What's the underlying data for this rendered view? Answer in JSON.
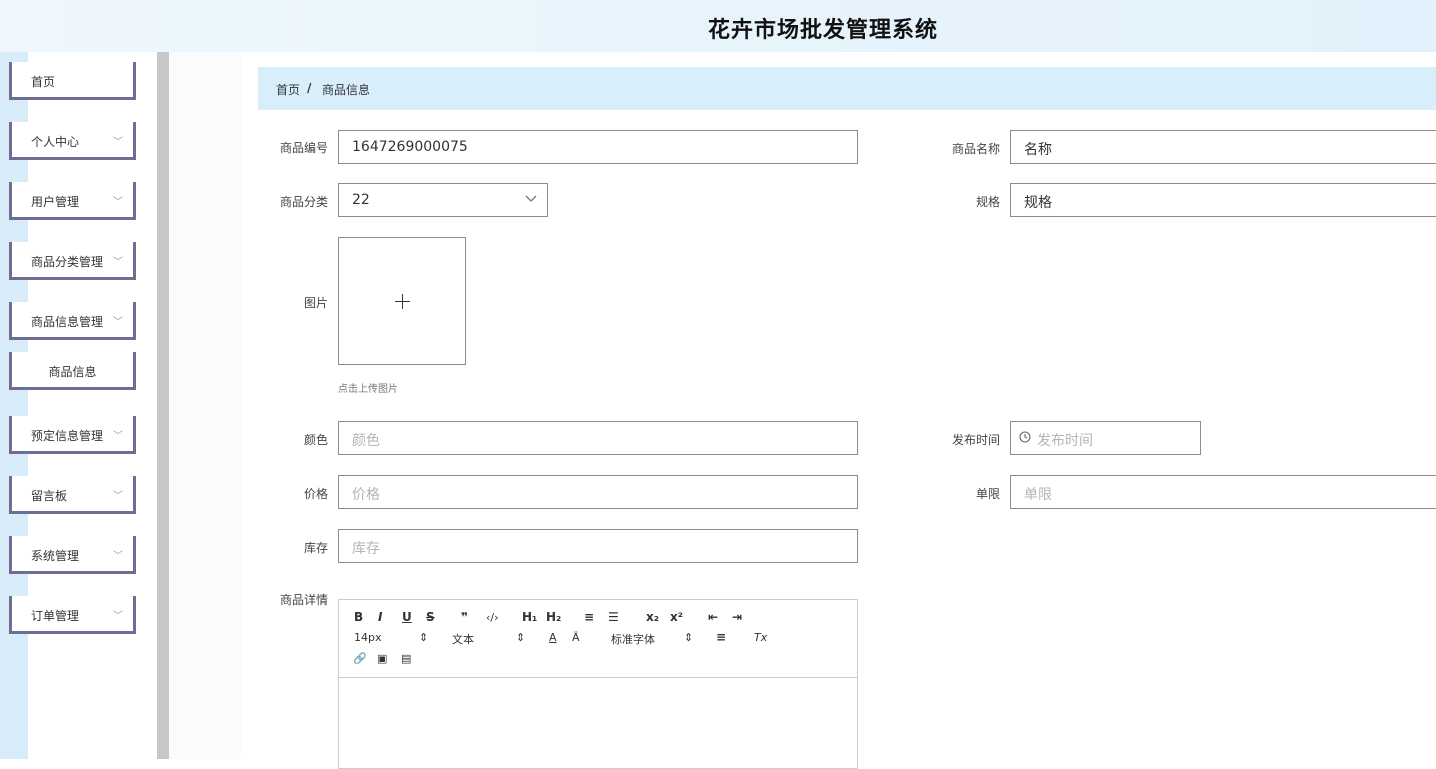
{
  "app": {
    "title": "花卉市场批发管理系统"
  },
  "sidebar": {
    "items": [
      {
        "label": "首页",
        "chevron": false
      },
      {
        "label": "个人中心",
        "chevron": true
      },
      {
        "label": "用户管理",
        "chevron": true
      },
      {
        "label": "商品分类管理",
        "chevron": true
      },
      {
        "label": "商品信息管理",
        "chevron": true
      },
      {
        "label": "商品信息",
        "chevron": false,
        "sub": true
      },
      {
        "label": "预定信息管理",
        "chevron": true
      },
      {
        "label": "留言板",
        "chevron": true
      },
      {
        "label": "系统管理",
        "chevron": true
      },
      {
        "label": "订单管理",
        "chevron": true
      }
    ],
    "chevron_glyph": "﹀"
  },
  "breadcrumb": {
    "home": "首页",
    "separator": "/",
    "current": "商品信息"
  },
  "form": {
    "code": {
      "label": "商品编号",
      "value": "1647269000075"
    },
    "name": {
      "label": "商品名称",
      "value": "名称"
    },
    "category": {
      "label": "商品分类",
      "value": "22"
    },
    "spec": {
      "label": "规格",
      "value": "规格"
    },
    "image": {
      "label": "图片",
      "hint": "点击上传图片"
    },
    "color": {
      "label": "颜色",
      "placeholder": "颜色"
    },
    "publish_time": {
      "label": "发布时间",
      "placeholder": "发布时间"
    },
    "price": {
      "label": "价格",
      "placeholder": "价格"
    },
    "limit": {
      "label": "单限",
      "placeholder": "单限"
    },
    "stock": {
      "label": "库存",
      "placeholder": "库存"
    },
    "detail": {
      "label": "商品详情"
    }
  },
  "editor": {
    "row1": [
      "B",
      "I",
      "U",
      "S",
      "❞",
      "‹/›",
      "H₁",
      "H₂",
      "≡",
      "☰",
      "x₂",
      "x²",
      "⇤",
      "⇥"
    ],
    "font_size": "14px",
    "block_type": "文本",
    "font_family": "标准字体",
    "select_arrow": "⇕",
    "row3": [
      "🔗",
      "▣",
      "▤"
    ],
    "color_icon": "A",
    "bg_icon": "Ä",
    "align_icon": "≡",
    "clear_icon": "Tx"
  },
  "colors": {
    "accent": "#6e6d93",
    "header_bg": "#d8effb",
    "strip": "#d7ebf9"
  }
}
